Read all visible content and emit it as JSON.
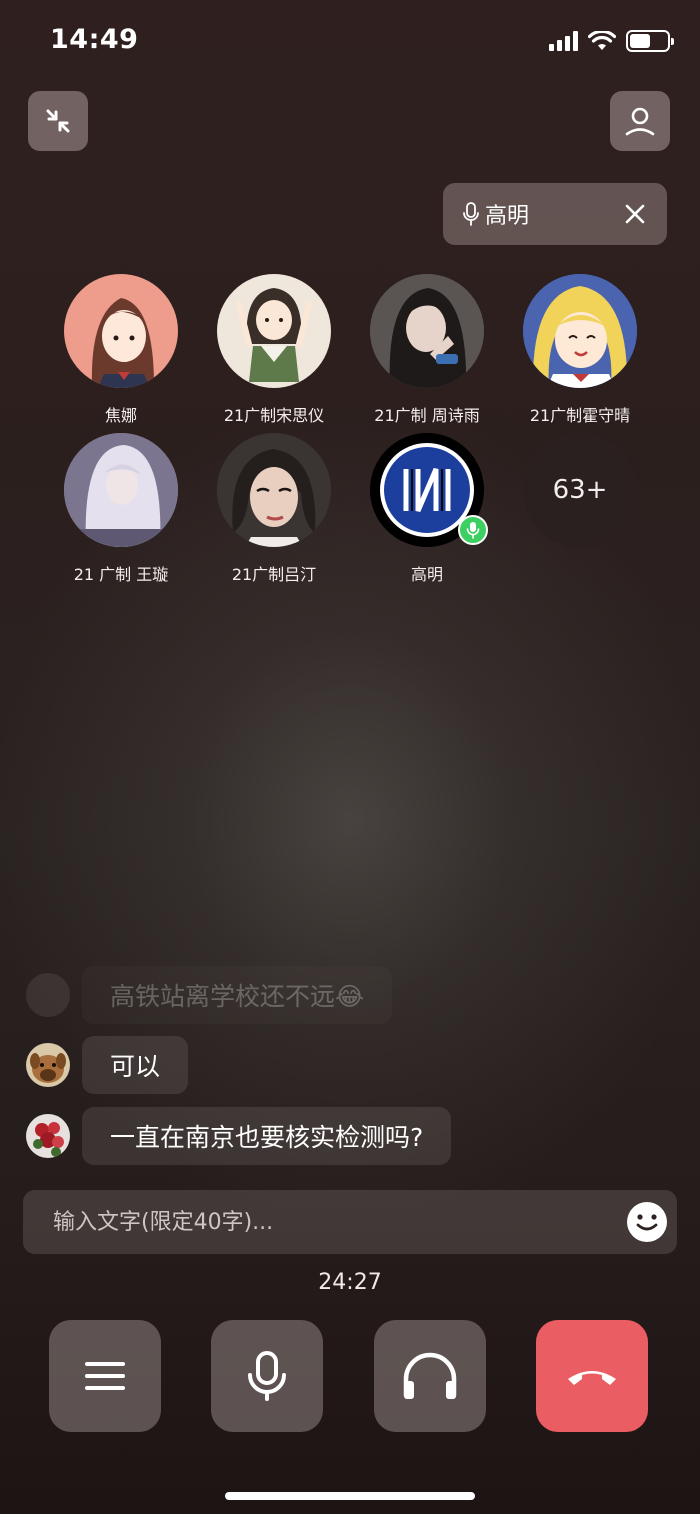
{
  "status_bar": {
    "time": "14:49"
  },
  "speaker": {
    "name": "高明"
  },
  "participants": [
    {
      "name": "焦娜",
      "avatar": "cartoon-girl-avatar"
    },
    {
      "name": "21广制宋思仪",
      "avatar": "cartoon-sweater-avatar"
    },
    {
      "name": "21广制 周诗雨",
      "avatar": "photo-girl-avatar"
    },
    {
      "name": "21广制霍守晴",
      "avatar": "sailor-moon-avatar"
    },
    {
      "name": "21 广制 王璇",
      "avatar": "photo-silver-hair-avatar"
    },
    {
      "name": "21广制吕汀",
      "avatar": "cartoon-woman-avatar"
    },
    {
      "name": "高明",
      "avatar": "inter-logo-avatar",
      "speaking": true
    }
  ],
  "more_count": "63+",
  "chat": {
    "messages": [
      {
        "text": "高铁站离学校还不远😂",
        "faded": true
      },
      {
        "text": "可以"
      },
      {
        "text": "一直在南京也要核实检测吗?"
      }
    ],
    "input_placeholder": "输入文字(限定40字)..."
  },
  "timer": "24:27",
  "colors": {
    "hangup": "#ea5d62",
    "speaking": "#3ecf63"
  },
  "controls": [
    "menu-icon",
    "microphone-icon",
    "headphones-icon",
    "hang-up-icon"
  ]
}
